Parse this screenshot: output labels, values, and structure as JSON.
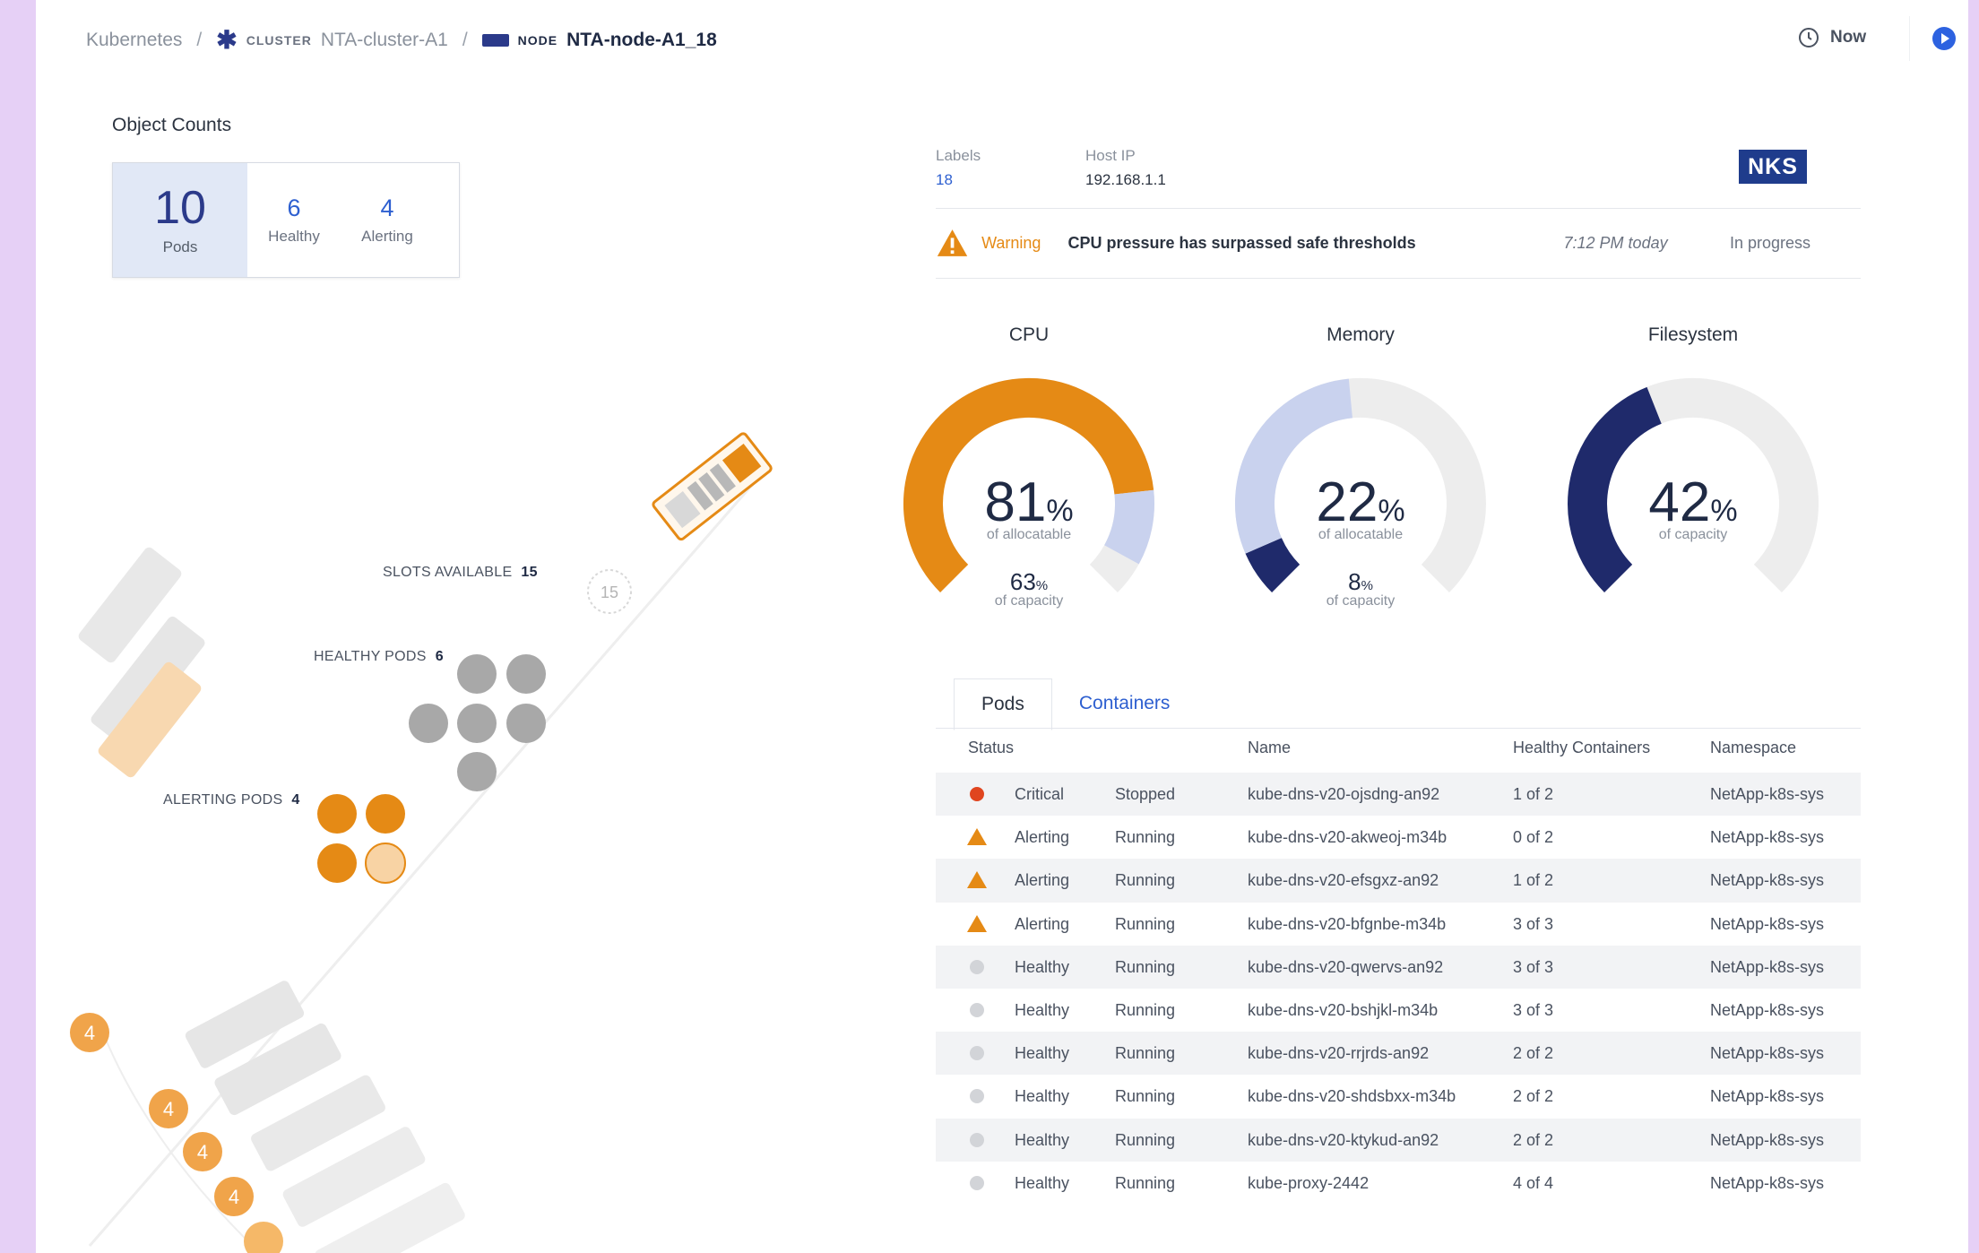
{
  "breadcrumb": {
    "root": "Kubernetes",
    "separator": "/",
    "cluster_tag": "CLUSTER",
    "cluster_name": "NTA-cluster-A1",
    "node_tag": "NODE",
    "node_name": "NTA-node-A1_18"
  },
  "header": {
    "time_label": "Now"
  },
  "object_counts": {
    "title": "Object Counts",
    "total": "10",
    "total_label": "Pods",
    "healthy": "6",
    "healthy_label": "Healthy",
    "alerting": "4",
    "alerting_label": "Alerting"
  },
  "diagram": {
    "slots_label": "SLOTS AVAILABLE",
    "slots_value": "15",
    "slots_ring": "15",
    "healthy_label": "HEALTHY PODS",
    "healthy_value": "6",
    "alerting_label": "ALERTING PODS",
    "alerting_value": "4",
    "other_node_counts": [
      "4",
      "4",
      "4",
      "4"
    ],
    "colors": {
      "alerting": "#e58a15",
      "alerting_light": "#f8d3a4",
      "healthy": "#a8a8a8",
      "inactive": "#e3e3e3"
    }
  },
  "node_info": {
    "labels_label": "Labels",
    "labels_value": "18",
    "hostip_label": "Host IP",
    "hostip_value": "192.168.1.1",
    "badge": "NKS"
  },
  "alert": {
    "type": "Warning",
    "message": "CPU pressure has surpassed safe thresholds",
    "time": "7:12 PM today",
    "status": "In progress"
  },
  "gauges": [
    {
      "title": "CPU",
      "percent": "81",
      "unit": "%",
      "sub": "of allocatable",
      "capacity": "63",
      "capacity_unit": "%",
      "capacity_sub": "of capacity",
      "fill": 0.81,
      "secondary": 0.13,
      "color": "#e58a15",
      "secondary_color": "#c9d2ee"
    },
    {
      "title": "Memory",
      "percent": "22",
      "unit": "%",
      "sub": "of allocatable",
      "capacity": "8",
      "capacity_unit": "%",
      "capacity_sub": "of capacity",
      "fill": 0.08,
      "secondary": 0.4,
      "color": "#1f2a6b",
      "secondary_color": "#c9d2ee"
    },
    {
      "title": "Filesystem",
      "percent": "42",
      "unit": "%",
      "sub": "of capacity",
      "fill": 0.42,
      "secondary": 0,
      "color": "#1f2a6b",
      "secondary_color": "#c9d2ee"
    }
  ],
  "tabs": [
    {
      "label": "Pods"
    },
    {
      "label": "Containers"
    }
  ],
  "table": {
    "columns": {
      "status": "Status",
      "name": "Name",
      "healthy_containers": "Healthy Containers",
      "namespace": "Namespace"
    },
    "rows": [
      {
        "severity": "critical",
        "status": "Critical",
        "state": "Stopped",
        "name": "kube-dns-v20-ojsdng-an92",
        "hc": "1 of 2",
        "ns": "NetApp-k8s-sys"
      },
      {
        "severity": "alerting",
        "status": "Alerting",
        "state": "Running",
        "name": "kube-dns-v20-akweoj-m34b",
        "hc": "0 of 2",
        "ns": "NetApp-k8s-sys"
      },
      {
        "severity": "alerting",
        "status": "Alerting",
        "state": "Running",
        "name": "kube-dns-v20-efsgxz-an92",
        "hc": "1 of 2",
        "ns": "NetApp-k8s-sys"
      },
      {
        "severity": "alerting",
        "status": "Alerting",
        "state": "Running",
        "name": "kube-dns-v20-bfgnbe-m34b",
        "hc": "3 of 3",
        "ns": "NetApp-k8s-sys"
      },
      {
        "severity": "healthy",
        "status": "Healthy",
        "state": "Running",
        "name": "kube-dns-v20-qwervs-an92",
        "hc": "3 of 3",
        "ns": "NetApp-k8s-sys"
      },
      {
        "severity": "healthy",
        "status": "Healthy",
        "state": "Running",
        "name": "kube-dns-v20-bshjkl-m34b",
        "hc": "3 of 3",
        "ns": "NetApp-k8s-sys"
      },
      {
        "severity": "healthy",
        "status": "Healthy",
        "state": "Running",
        "name": "kube-dns-v20-rrjrds-an92",
        "hc": "2 of 2",
        "ns": "NetApp-k8s-sys"
      },
      {
        "severity": "healthy",
        "status": "Healthy",
        "state": "Running",
        "name": "kube-dns-v20-shdsbxx-m34b",
        "hc": "2 of 2",
        "ns": "NetApp-k8s-sys"
      },
      {
        "severity": "healthy",
        "status": "Healthy",
        "state": "Running",
        "name": "kube-dns-v20-ktykud-an92",
        "hc": "2 of 2",
        "ns": "NetApp-k8s-sys"
      },
      {
        "severity": "healthy",
        "status": "Healthy",
        "state": "Running",
        "name": "kube-proxy-2442",
        "hc": "4 of 4",
        "ns": "NetApp-k8s-sys"
      }
    ]
  },
  "colors": {
    "critical": "#e0451f",
    "alerting": "#e58a15",
    "healthy": "#d2d4d8",
    "accent": "#2d5fd0",
    "navy": "#1f2a6b"
  }
}
